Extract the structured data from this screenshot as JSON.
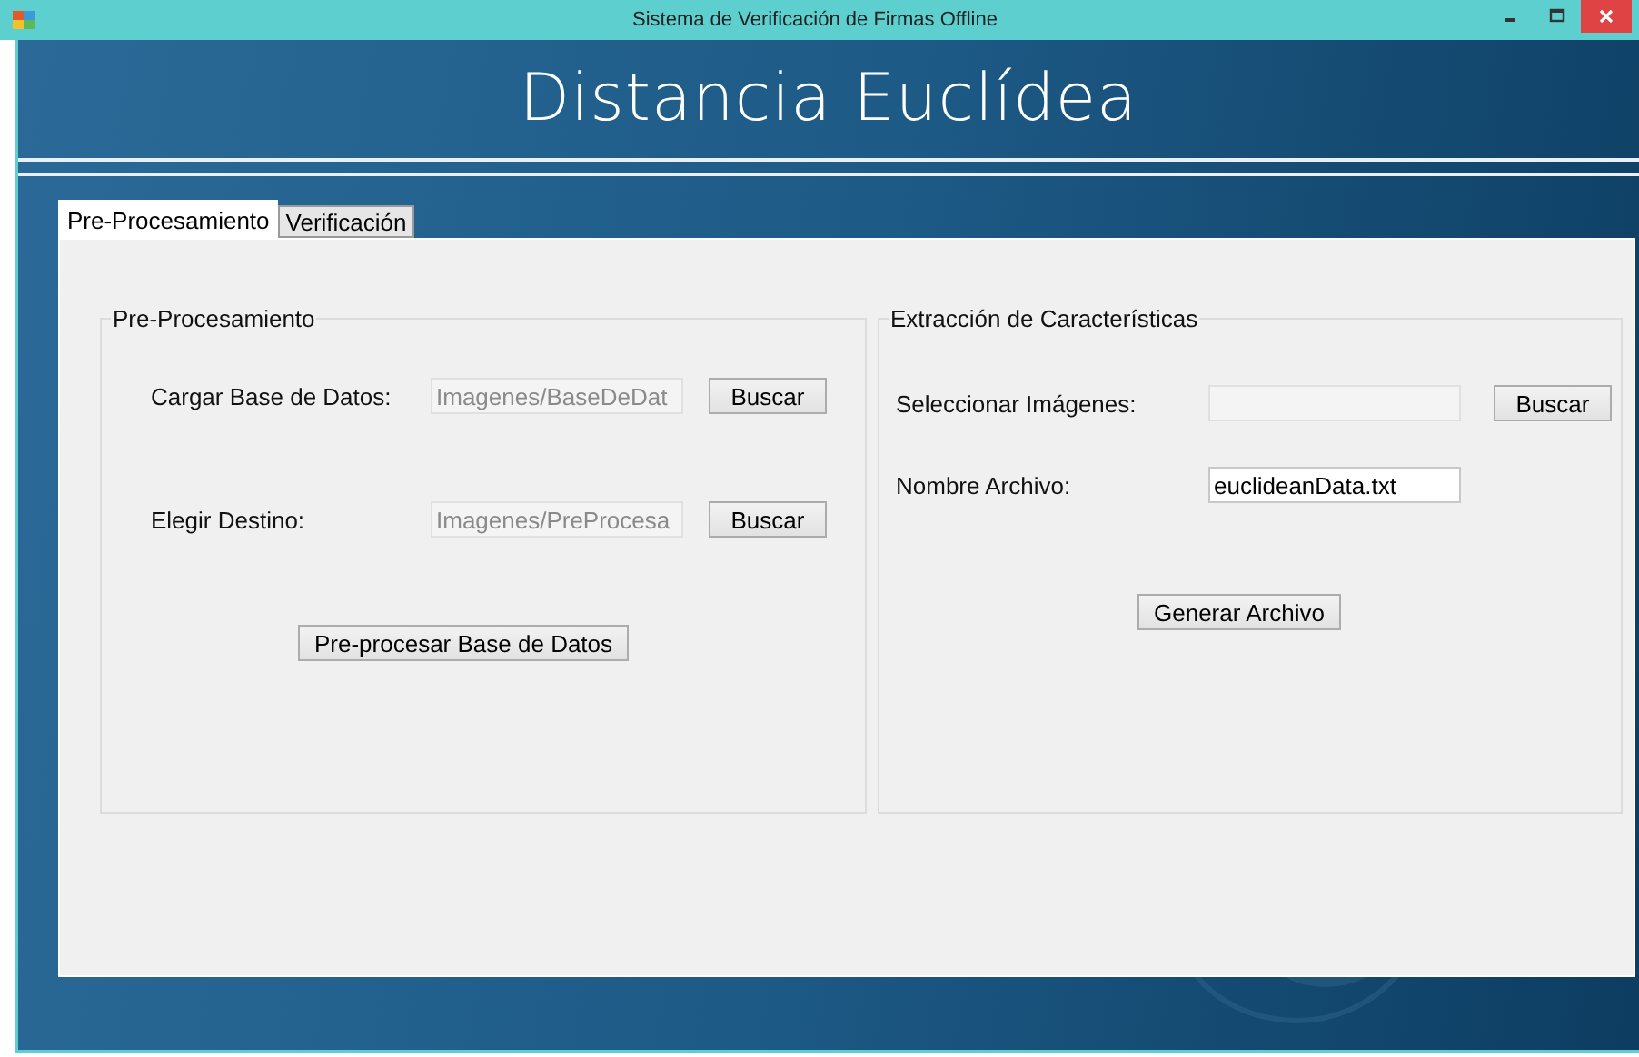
{
  "window": {
    "title": "Sistema de Verificación de Firmas Offline"
  },
  "heading": "Distancia Euclídea",
  "tabs": [
    {
      "label": "Pre-Procesamiento",
      "selected": true
    },
    {
      "label": "Verificación",
      "selected": false
    }
  ],
  "groups": [
    {
      "title": "Pre-Procesamiento",
      "rows": [
        {
          "kind": "field",
          "label": "Cargar Base de Datos:",
          "value": "Imagenes/BaseDeDat",
          "disabled": true,
          "button": "Buscar"
        },
        {
          "kind": "field",
          "label": "Elegir Destino:",
          "value": "Imagenes/PreProcesa",
          "disabled": true,
          "button": "Buscar"
        },
        {
          "kind": "action",
          "button": "Pre-procesar Base de Datos"
        }
      ]
    },
    {
      "title": "Extracción de Características",
      "rows": [
        {
          "kind": "field",
          "label": "Seleccionar Imágenes:",
          "disabled": true,
          "button": "Buscar"
        },
        {
          "kind": "field",
          "label": "Nombre Archivo:",
          "value": "euclideanData.txt",
          "disabled": false
        },
        {
          "kind": "action",
          "button": "Generar Archivo"
        }
      ]
    }
  ]
}
